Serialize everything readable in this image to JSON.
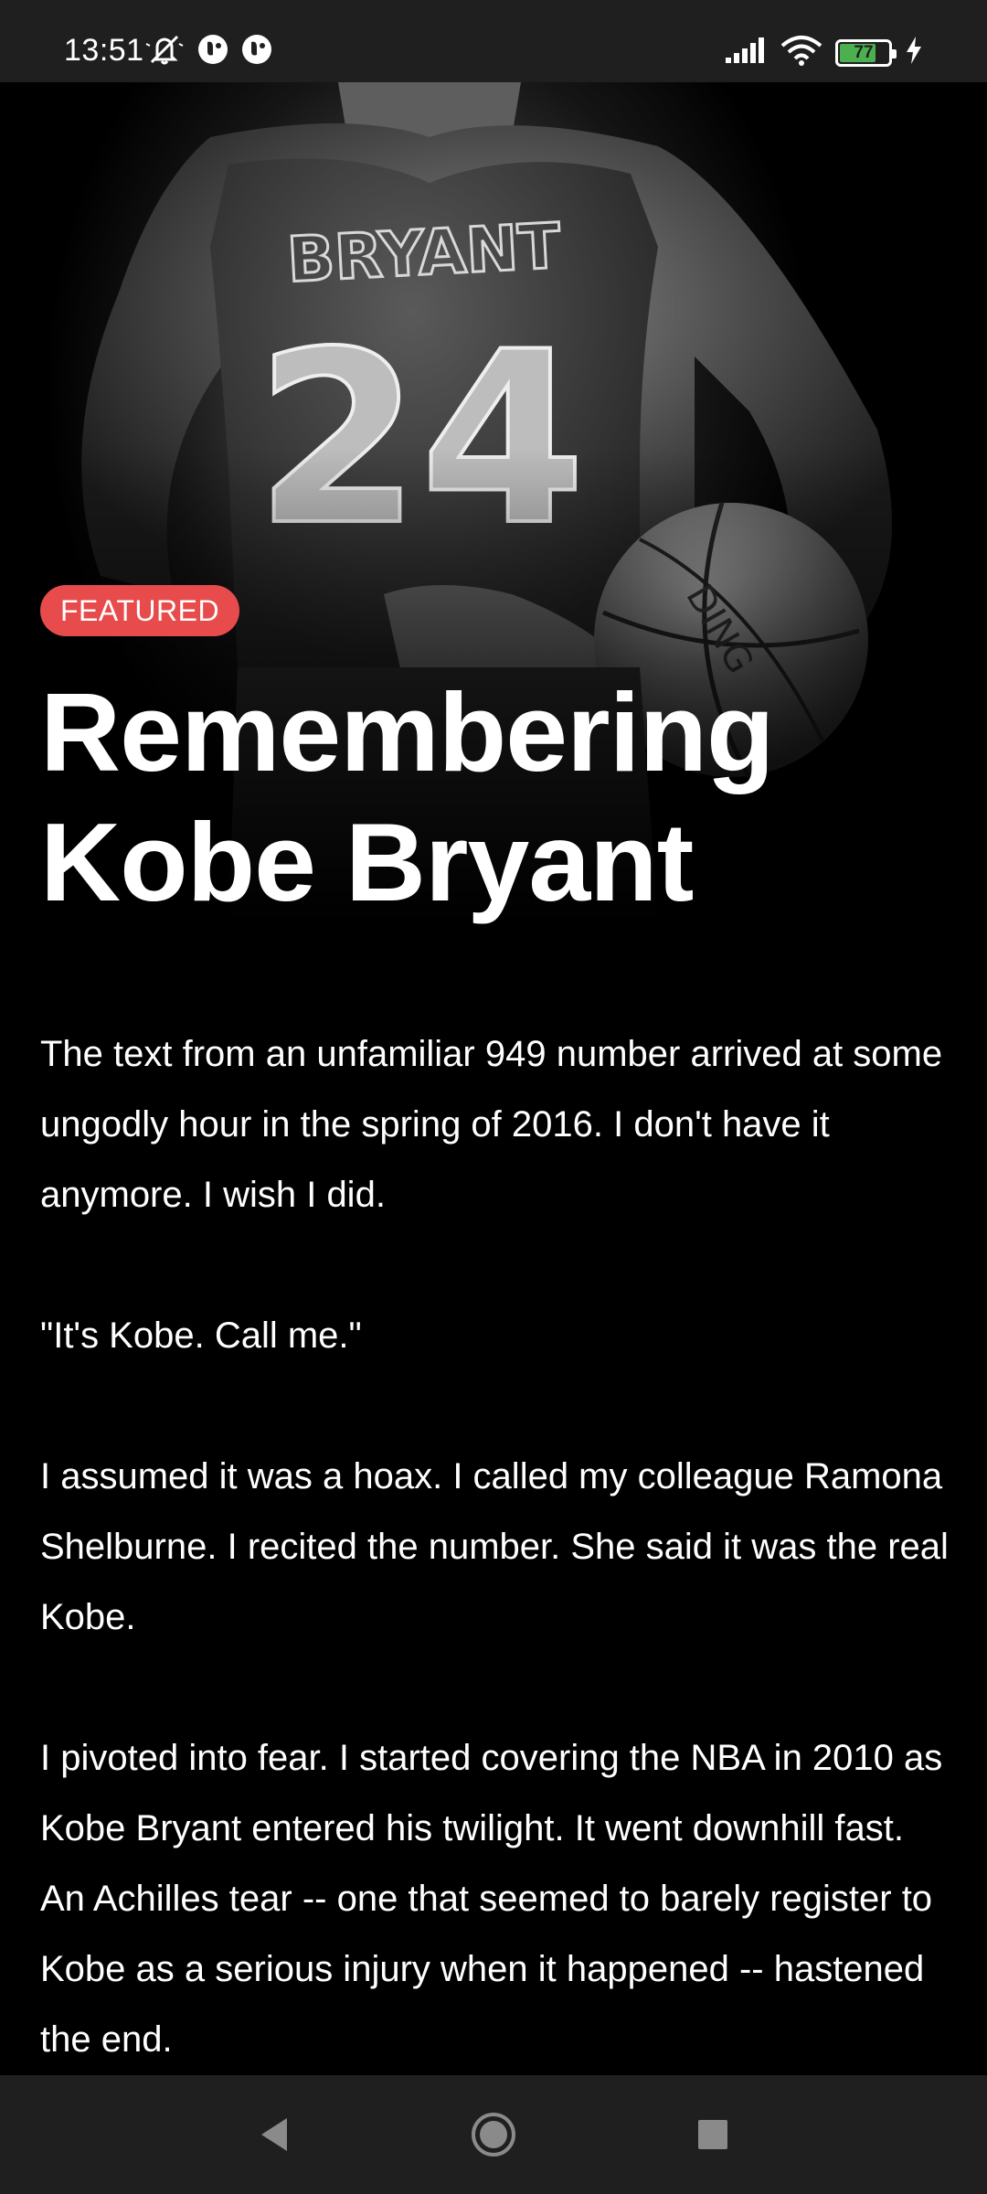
{
  "status_bar": {
    "time": "13:51",
    "battery_level": 77,
    "battery_text": "77",
    "left_icons": [
      "mute-icon",
      "notification-app-icon",
      "notification-app-icon"
    ],
    "right_icons": [
      "signal-icon",
      "wifi-icon",
      "battery-icon",
      "charging-icon"
    ]
  },
  "hero": {
    "image_description": "kobe-bryant-jersey-24-back-photo"
  },
  "article": {
    "badge": "FEATURED",
    "title": "Remembering Kobe Bryant",
    "paragraphs": [
      "The text from an unfamiliar 949 number arrived at some ungodly hour in the spring of 2016. I don't have it anymore. I wish I did.",
      "\"It's Kobe. Call me.\"",
      "I assumed it was a hoax. I called my colleague Ramona Shelburne. I recited the number. She said it was the real Kobe.",
      "I pivoted into fear. I started covering the NBA in 2010 as Kobe Bryant entered his twilight. It went downhill fast. An Achilles tear -- one that seemed to barely register to Kobe as a serious injury when it happened -- hastened the end."
    ]
  },
  "nav_bar": {
    "buttons": [
      "back",
      "home",
      "recents"
    ]
  },
  "colors": {
    "badge_bg": "#e84b4b",
    "background": "#000000",
    "bars": "#1f1f1f",
    "battery_fill": "#4caf50"
  }
}
